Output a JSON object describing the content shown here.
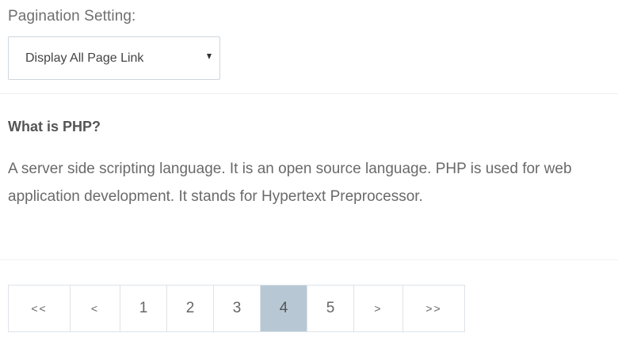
{
  "pagination_setting": {
    "label": "Pagination Setting:",
    "selected_option": "Display All Page Link"
  },
  "faq": {
    "question": "What is PHP?",
    "answer": "A server side scripting language. It is an open source language. PHP is used for web application development. It stands for Hypertext Preprocessor."
  },
  "pagination": {
    "first_label": "<<",
    "prev_label": "<",
    "pages": [
      "1",
      "2",
      "3",
      "4",
      "5"
    ],
    "current_page": "4",
    "next_label": ">",
    "last_label": ">>"
  },
  "colors": {
    "active_page_bg": "#b7c8d4",
    "border": "#dde3e8"
  },
  "icons": {
    "dropdown": "caret-down-icon"
  }
}
